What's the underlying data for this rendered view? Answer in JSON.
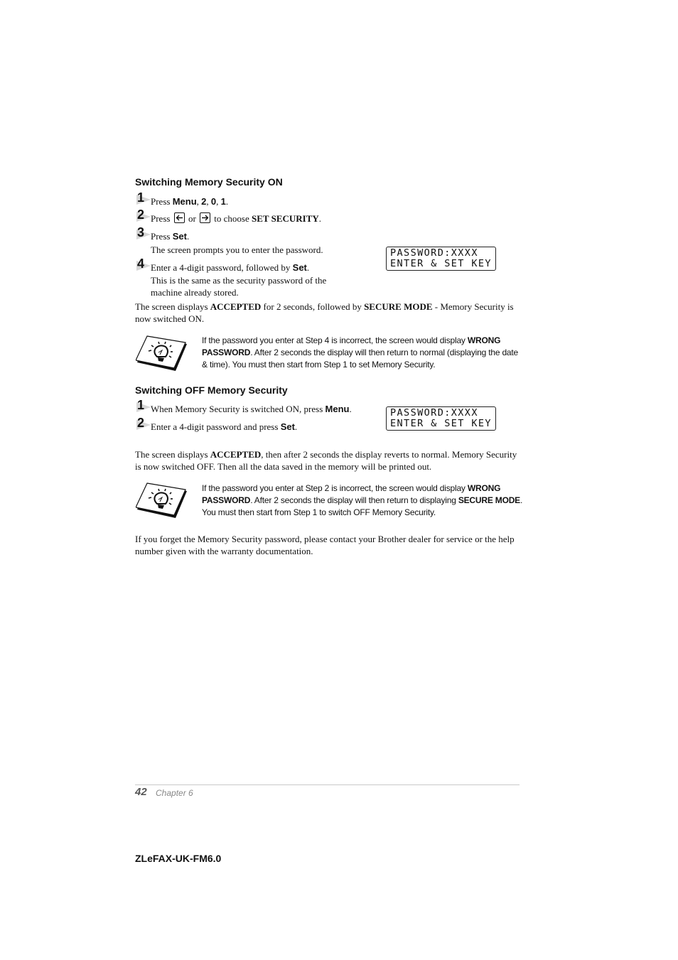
{
  "section_on": {
    "heading": "Switching Memory Security ON",
    "steps": [
      {
        "num": "1",
        "pre": "Press ",
        "b1": "Menu",
        "mid1": ", ",
        "b2": "2",
        "mid2": ", ",
        "b3": "0",
        "mid3": ", ",
        "b4": "1",
        "post": "."
      },
      {
        "num": "2",
        "pre": "Press ",
        "mid": " or ",
        "mid2": " to choose ",
        "bold": "SET SECURITY",
        "post": ".",
        "left_icon": "left-arrow-key-icon",
        "right_icon": "right-arrow-key-icon"
      },
      {
        "num": "3",
        "pre": "Press ",
        "bold": "Set",
        "post": ".",
        "sub": "The screen prompts you to enter the password."
      },
      {
        "num": "4",
        "pre": "Enter a 4-digit password, followed by ",
        "bold": "Set",
        "post": ".",
        "sub1": "This is the same as the security password of the",
        "sub2": "machine already stored."
      }
    ],
    "lcd": {
      "line1": "PASSWORD:XXXX",
      "line2": "ENTER & SET KEY"
    },
    "result": {
      "t1": "The screen displays ",
      "b1": "ACCEPTED",
      "t2": " for 2 seconds, followed by ",
      "b2": "SECURE MODE",
      "t3": " - Memory Security is now switched ON."
    },
    "note": {
      "icon": "lightbulb-note-icon",
      "t1": "If the password you enter at Step 4 is incorrect, the screen would display ",
      "b1": "WRONG PASSWORD",
      "t2": ". After 2 seconds the display will then return to normal (displaying the date & time). You must then start from Step 1 to set Memory Security."
    }
  },
  "section_off": {
    "heading": "Switching OFF Memory Security",
    "steps": [
      {
        "num": "1",
        "pre": "When Memory Security is switched ON, press ",
        "bold": "Menu",
        "post": "."
      },
      {
        "num": "2",
        "pre": "Enter a 4-digit password and press ",
        "bold": "Set",
        "post": "."
      }
    ],
    "lcd": {
      "line1": "PASSWORD:XXXX",
      "line2": "ENTER & SET KEY"
    },
    "result": {
      "t1": "The screen displays ",
      "b1": "ACCEPTED",
      "t2": ", then after 2 seconds the display reverts to normal. Memory Security is now switched OFF. Then all the data saved in the memory will be printed out."
    },
    "note": {
      "icon": "lightbulb-note-icon",
      "t1": "If the password you enter at Step 2 is incorrect, the screen would display ",
      "b1": "WRONG PASSWORD",
      "t2": ". After 2 seconds the display will then return to displaying ",
      "b2": "SECURE MODE",
      "t3": ". You must then start from Step 1 to switch OFF Memory Security."
    }
  },
  "forget_paragraph": "If you forget the Memory Security password, please contact your Brother dealer for service or the help number given with the warranty documentation.",
  "footer": {
    "page_number": "42",
    "chapter": "Chapter 6",
    "doc_id": "ZLeFAX-UK-FM6.0"
  }
}
